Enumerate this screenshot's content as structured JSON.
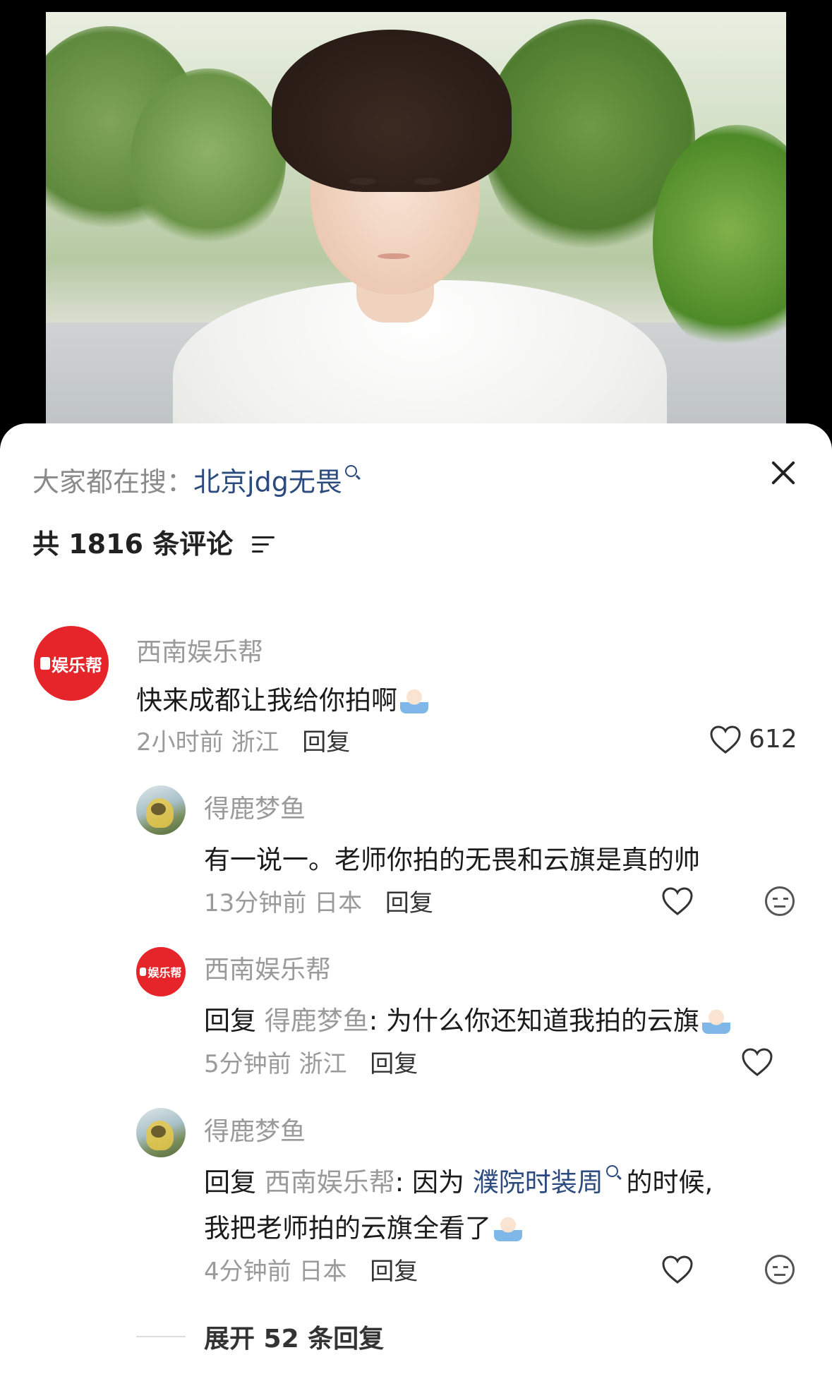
{
  "hot_search": {
    "prefix": "大家都在搜：",
    "term": "北京jdg无畏"
  },
  "comment_count": "共 1816 条评论",
  "comments": [
    {
      "author": "西南娱乐帮",
      "avatar_text": "娱乐帮",
      "text": "快来成都让我给你拍啊",
      "time": "2小时前",
      "location": "浙江",
      "reply_label": "回复",
      "likes": "612"
    },
    {
      "author": "得鹿梦鱼",
      "text": "有一说一。老师你拍的无畏和云旗是真的帅",
      "time": "13分钟前",
      "location": "日本",
      "reply_label": "回复"
    },
    {
      "author": "西南娱乐帮",
      "avatar_text": "娱乐帮",
      "reply_prefix": "回复",
      "reply_to": "得鹿梦鱼",
      "text": ": 为什么你还知道我拍的云旗",
      "time": "5分钟前",
      "location": "浙江",
      "reply_label": "回复"
    },
    {
      "author": "得鹿梦鱼",
      "reply_prefix": "回复",
      "reply_to": "西南娱乐帮",
      "text_a": ": 因为",
      "link": "濮院时装周",
      "text_b": "的时候,",
      "line2": "我把老师拍的云旗全看了",
      "time": "4分钟前",
      "location": "日本",
      "reply_label": "回复"
    }
  ],
  "expand_replies": "展开 52 条回复",
  "colors": {
    "link": "#2b4a7e",
    "muted": "#9a9a9a",
    "avatar_red": "#e5252a"
  }
}
